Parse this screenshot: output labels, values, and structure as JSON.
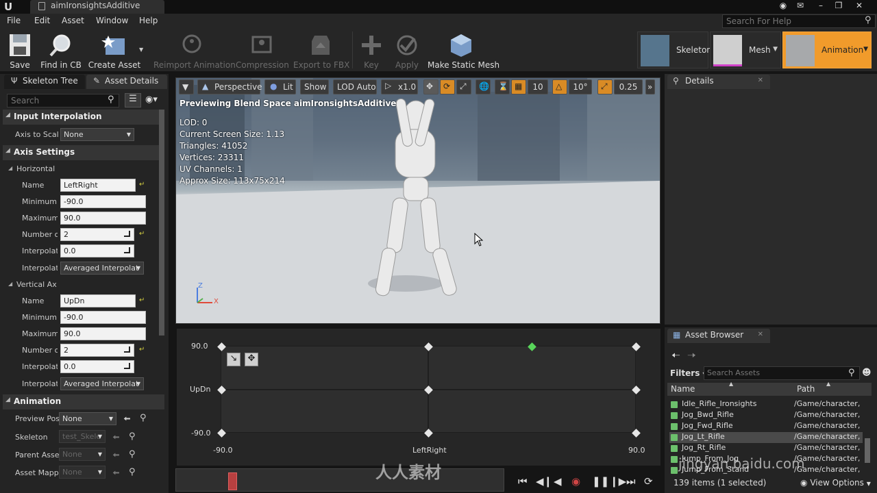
{
  "window": {
    "tab_title": "aimIronsightsAdditive",
    "logo": "U"
  },
  "menu": [
    "File",
    "Edit",
    "Asset",
    "Window",
    "Help"
  ],
  "help_search_placeholder": "Search For Help",
  "toolbar": {
    "save": "Save",
    "find_in_cb": "Find in CB",
    "create_asset": "Create Asset",
    "reimport": "Reimport Animation",
    "compression": "Compression",
    "export_fbx": "Export to FBX",
    "key": "Key",
    "apply": "Apply",
    "make_static_mesh": "Make Static Mesh"
  },
  "modes": {
    "skeleton": "Skeleton",
    "mesh": "Mesh",
    "animation": "Animation"
  },
  "left_tabs": {
    "skeleton_tree": "Skeleton Tree",
    "asset_details": "Asset Details"
  },
  "left_search_placeholder": "Search",
  "input_interpolation": {
    "header": "Input Interpolation",
    "axis_to_scale_label": "Axis to Scal",
    "axis_to_scale_value": "None"
  },
  "axis_settings": {
    "header": "Axis Settings",
    "horizontal": {
      "title": "Horizontal",
      "name_label": "Name",
      "name": "LeftRight",
      "min_label": "Minimum",
      "min": "-90.0",
      "max_label": "Maximum",
      "max": "90.0",
      "grid_label": "Number o",
      "grid": "2",
      "interp_time_label": "Interpolati",
      "interp_time": "0.0",
      "interp_type_label": "Interpolati",
      "interp_type": "Averaged Interpolat"
    },
    "vertical": {
      "title": "Vertical Ax",
      "name_label": "Name",
      "name": "UpDn",
      "min_label": "Minimum",
      "min": "-90.0",
      "max_label": "Maximum",
      "max": "90.0",
      "grid_label": "Number o",
      "grid": "2",
      "interp_time_label": "Interpolati",
      "interp_time": "0.0",
      "interp_type_label": "Interpolati",
      "interp_type": "Averaged Interpolat"
    }
  },
  "animation_section": {
    "header": "Animation",
    "preview_pose_label": "Preview Pos",
    "preview_pose": "None",
    "skeleton_label": "Skeleton",
    "skeleton": "test_Skele",
    "parent_asset_label": "Parent Asse",
    "parent_asset": "None",
    "asset_mapping_label": "Asset Mapp",
    "asset_mapping": "None"
  },
  "viewport": {
    "perspective": "Perspective",
    "lit": "Lit",
    "show": "Show",
    "lod": "LOD Auto",
    "speed": "x1.0",
    "grid_snap": "10",
    "rot_snap": "10°",
    "scale_snap": "0.25",
    "preview_title": "Previewing Blend Space aimIronsightsAdditive",
    "stats": [
      "LOD: 0",
      "Current Screen Size: 1.13",
      "Triangles: 41052",
      "Vertices: 23311",
      "UV Channels: 1",
      "Approx Size: 113x75x214"
    ],
    "axis_z": "Z",
    "axis_x": "X"
  },
  "blendspace": {
    "y_top": "90.0",
    "y_mid": "UpDn",
    "y_bottom": "-90.0",
    "x_left": "-90.0",
    "x_mid": "LeftRight",
    "x_right": "90.0",
    "samples": [
      {
        "x": -90,
        "y": 90
      },
      {
        "x": 0,
        "y": 90
      },
      {
        "x": 45,
        "y": 90,
        "highlight": true
      },
      {
        "x": 90,
        "y": 90
      },
      {
        "x": -90,
        "y": 0
      },
      {
        "x": 0,
        "y": 0
      },
      {
        "x": 90,
        "y": 0
      },
      {
        "x": -90,
        "y": -90
      },
      {
        "x": 0,
        "y": -90
      },
      {
        "x": 90,
        "y": -90
      }
    ]
  },
  "details": {
    "tab": "Details"
  },
  "asset_browser": {
    "tab": "Asset Browser",
    "filters": "Filters",
    "search_placeholder": "Search Assets",
    "col_name": "Name",
    "col_path": "Path",
    "rows": [
      {
        "name": "Idle_Rifle_Ironsights",
        "path": "/Game/character,"
      },
      {
        "name": "Jog_Bwd_Rifle",
        "path": "/Game/character,"
      },
      {
        "name": "Jog_Fwd_Rifle",
        "path": "/Game/character,"
      },
      {
        "name": "Jog_Lt_Rifle",
        "path": "/Game/character,",
        "selected": true
      },
      {
        "name": "Jog_Rt_Rifle",
        "path": "/Game/character,"
      },
      {
        "name": "Jump_From_Jog",
        "path": "/Game/character,"
      },
      {
        "name": "Jump_From_Stand",
        "path": "/Game/character,"
      }
    ],
    "status": "139 items (1 selected)",
    "view_options": "View Options"
  },
  "watermarks": {
    "rrsc": "人人素材",
    "baidu": "jingyan.baidu.com"
  }
}
